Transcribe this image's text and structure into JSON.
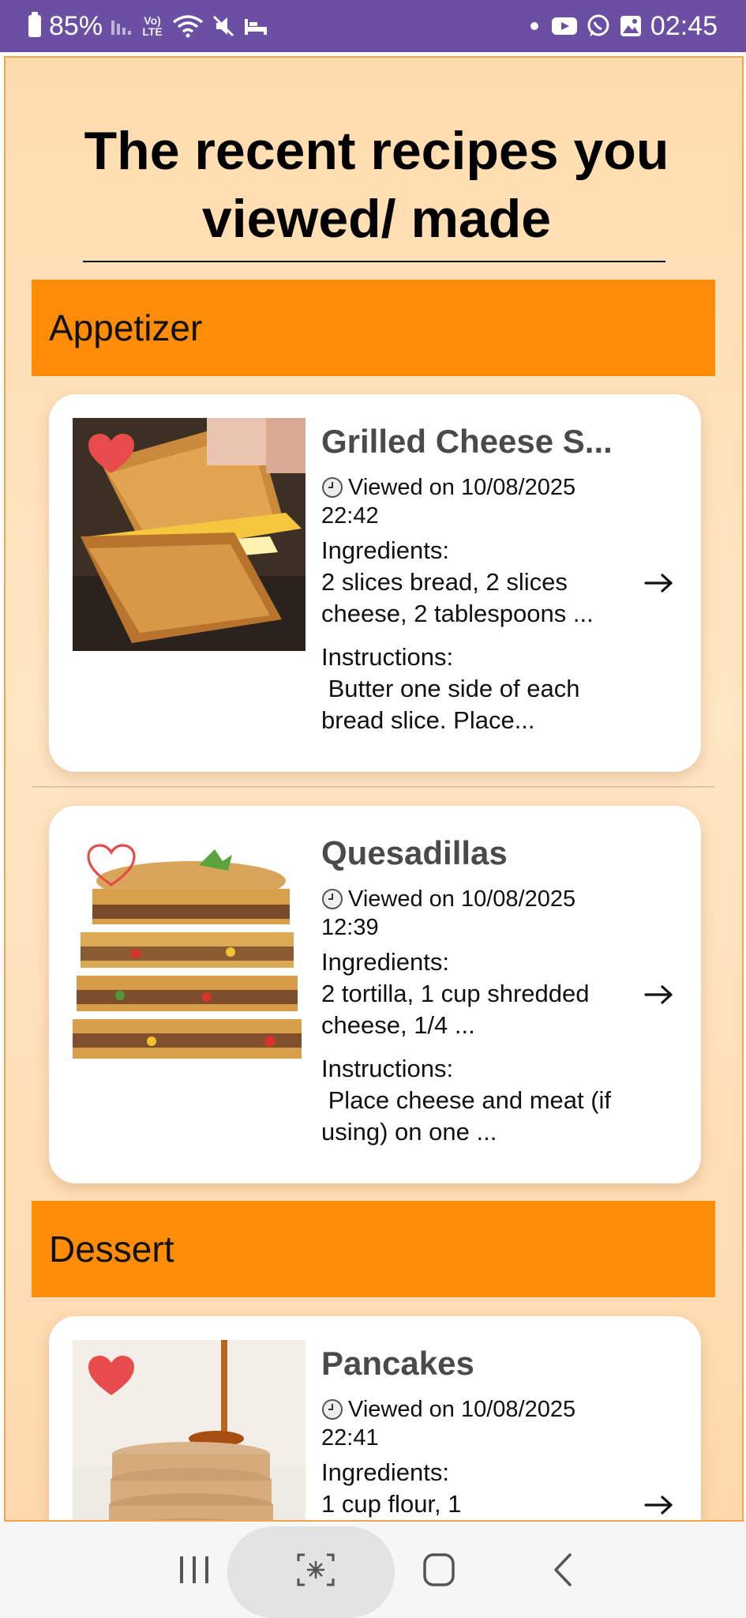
{
  "status_bar": {
    "battery": "85%",
    "network_badge": "Vo) LTE",
    "time": "02:45",
    "icons": [
      "battery-icon",
      "signal-icon",
      "volte-icon",
      "wifi-icon",
      "mute-icon",
      "sleep-icon",
      "dot-icon",
      "youtube-icon",
      "whatsapp-icon",
      "gallery-icon"
    ]
  },
  "page": {
    "title": "The recent recipes you viewed/ made"
  },
  "sections": [
    {
      "name": "Appetizer",
      "recipes": [
        {
          "title": "Grilled Cheese S...",
          "favorite": true,
          "viewed": "Viewed on 10/08/2025 22:42",
          "ingredients_label": "Ingredients:",
          "ingredients": "2 slices bread, 2 slices cheese, 2 tablespoons ...",
          "instructions_label": "Instructions:",
          "instructions": " Butter one side of each bread slice. Place..."
        },
        {
          "title": "Quesadillas",
          "favorite": false,
          "viewed": "Viewed on 10/08/2025 12:39",
          "ingredients_label": "Ingredients:",
          "ingredients": "2 tortilla, 1 cup shredded cheese, 1/4 ...",
          "instructions_label": "Instructions:",
          "instructions": " Place cheese and meat (if using) on one ..."
        }
      ]
    },
    {
      "name": "Dessert",
      "recipes": [
        {
          "title": "Pancakes",
          "favorite": true,
          "viewed": "Viewed on 10/08/2025 22:41",
          "ingredients_label": "Ingredients:",
          "ingredients": "1 cup flour, 1"
        }
      ]
    }
  ],
  "nav_bar": {
    "icons": [
      "recent-apps-icon",
      "screenshot-capture-icon",
      "home-icon",
      "back-icon"
    ]
  },
  "colors": {
    "status_bar": "#6a4fa3",
    "section_header": "#ff8c07",
    "favorite_heart": "#e84b4b",
    "page_bg": "#ffe0b5"
  }
}
